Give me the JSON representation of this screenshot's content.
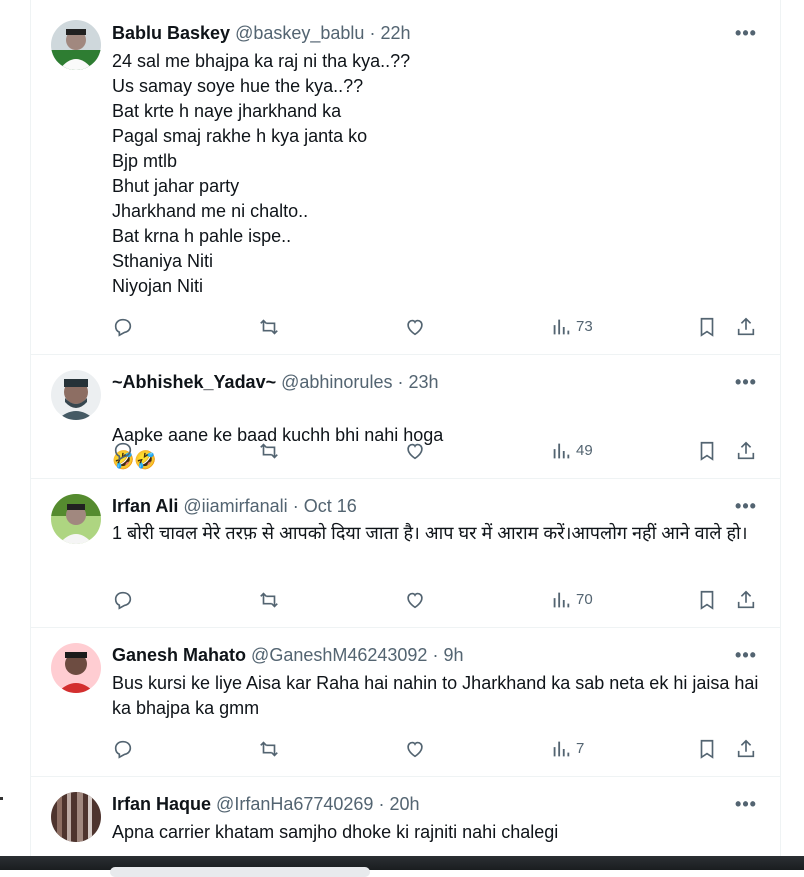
{
  "tweets": [
    {
      "name": "Bablu Baskey",
      "handle": "@baskey_bablu",
      "sep": "·",
      "time": "22h",
      "text": "24 sal me bhajpa ka raj ni tha kya..??\nUs samay soye hue the kya..??\nBat krte h naye jharkhand ka\nPagal smaj rakhe h kya janta ko\nBjp mtlb\nBhut jahar party\nJharkhand me ni chalto..\nBat krna h pahle ispe..\nSthaniya Niti\nNiyojan Niti",
      "views": "73",
      "avatar_color": "#2e7d32"
    },
    {
      "name": "~Abhishek_Yadav~",
      "handle": "@abhinorules",
      "sep": "·",
      "time": "23h",
      "text": "Aapke aane ke baad kuchh bhi nahi hoga",
      "emoji": "🤣🤣",
      "views": "49",
      "avatar_color": "#5d5d5d"
    },
    {
      "name": "Irfan Ali",
      "handle": "@iiamirfanali",
      "sep": "·",
      "time": "Oct 16",
      "text": "1 बोरी चावल मेरे तरफ़ से आपको दिया जाता है। आप घर में आराम करें।आपलोग नहीं आने वाले हो।",
      "views": "70",
      "avatar_color": "#8bc34a"
    },
    {
      "name": "Ganesh Mahato",
      "handle": "@GaneshM46243092",
      "sep": "·",
      "time": "9h",
      "text": "Bus kursi ke liye Aisa kar Raha hai nahin to Jharkhand ka sab neta ek hi jaisa hai ka bhajpa ka gmm",
      "views": "7",
      "avatar_color": "#c62828"
    },
    {
      "name": "Irfan Haque",
      "handle": "@IrfanHa67740269",
      "sep": "·",
      "time": "20h",
      "text": "Apna carrier khatam samjho dhoke ki rajniti nahi chalegi",
      "avatar_color": "#6d4c41"
    }
  ],
  "more_label": "•••"
}
